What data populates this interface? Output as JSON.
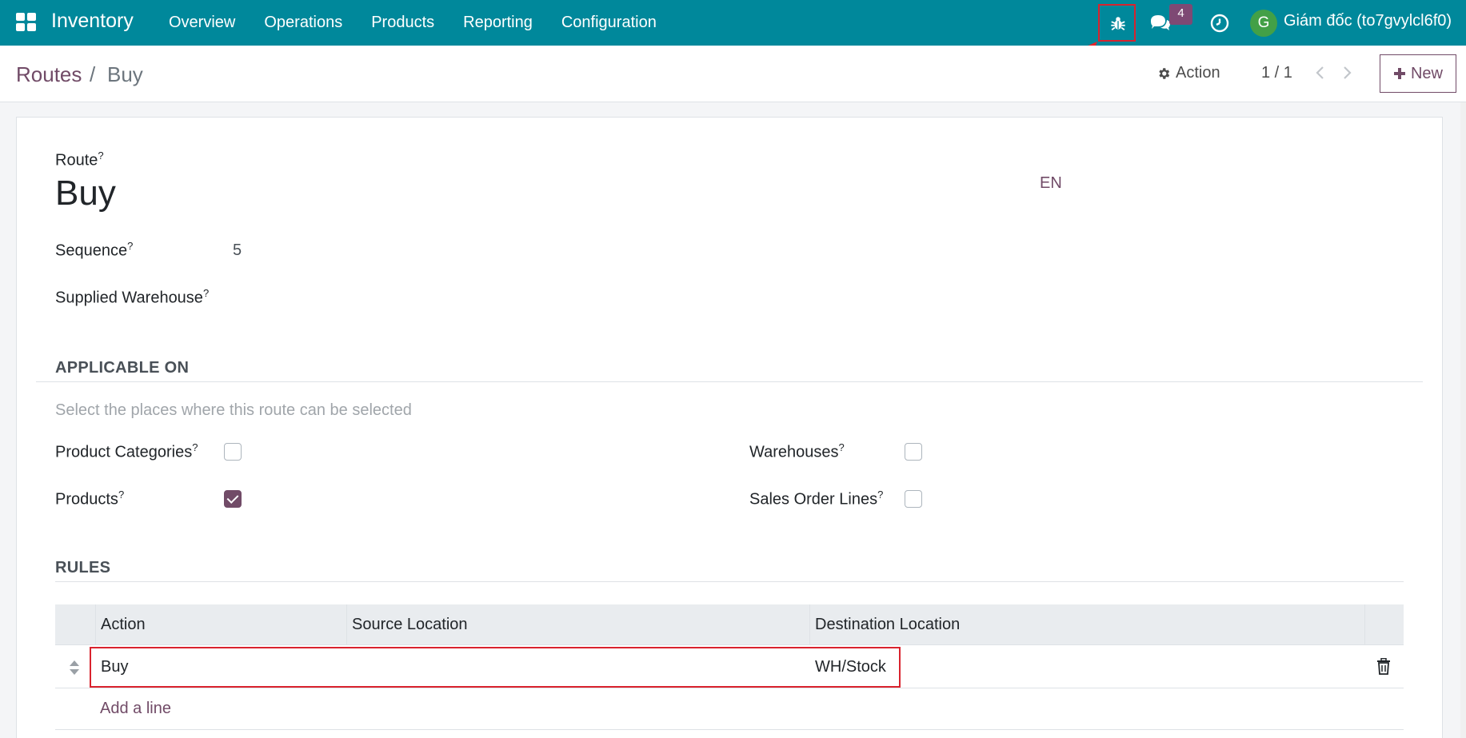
{
  "navbar": {
    "app_name": "Inventory",
    "menu": [
      "Overview",
      "Operations",
      "Products",
      "Reporting",
      "Configuration"
    ],
    "messages_count": "4",
    "user_initial": "G",
    "user_name": "Giám đốc (to7gvylcl6f0)",
    "bg_color": "#00889b"
  },
  "breadcrumb": {
    "parent": "Routes",
    "separator": "/",
    "current": "Buy"
  },
  "control": {
    "action_label": "Action",
    "pager": "1 / 1",
    "new_label": "New"
  },
  "form": {
    "route_label": "Route",
    "route_name": "Buy",
    "lang": "EN",
    "sequence_label": "Sequence",
    "sequence_value": "5",
    "supplied_warehouse_label": "Supplied Warehouse",
    "help_mark": "?",
    "applicable": {
      "title": "APPLICABLE ON",
      "hint": "Select the places where this route can be selected",
      "product_categories": {
        "label": "Product Categories",
        "checked": false
      },
      "products": {
        "label": "Products",
        "checked": true
      },
      "warehouses": {
        "label": "Warehouses",
        "checked": false
      },
      "sales_order_lines": {
        "label": "Sales Order Lines",
        "checked": false
      }
    },
    "rules": {
      "title": "RULES",
      "columns": [
        "Action",
        "Source Location",
        "Destination Location"
      ],
      "rows": [
        {
          "action": "Buy",
          "source": "",
          "destination": "WH/Stock"
        }
      ],
      "add_line": "Add a line"
    }
  },
  "colors": {
    "accent": "#714b67",
    "highlight": "#d9232e"
  }
}
